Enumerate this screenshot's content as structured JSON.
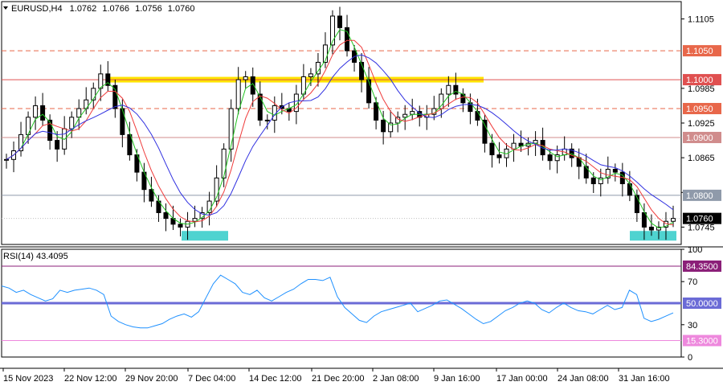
{
  "chart_data": {
    "type": "candlestick",
    "symbol_header": "EURUSD,H4",
    "ohlc_header": [
      "1.0762",
      "1.0766",
      "1.0756",
      "1.0760"
    ],
    "price_axis": {
      "range": [
        1.0715,
        1.1135
      ],
      "ticks": [
        1.1105,
        1.0985,
        1.0925,
        1.0865,
        1.0805,
        1.0745
      ],
      "levels": [
        {
          "value": 1.105,
          "label": "1.1050",
          "color": "#e8674a",
          "style": "dashed"
        },
        {
          "value": 1.1,
          "label": "1.1000",
          "color": "#e05050",
          "style": "solid"
        },
        {
          "value": 1.095,
          "label": "1.0950",
          "color": "#e8674a",
          "style": "dashed"
        },
        {
          "value": 1.09,
          "label": "1.0900",
          "color": "#d08c8c",
          "style": "solid"
        },
        {
          "value": 1.08,
          "label": "1.0800",
          "color": "#8f9aaa",
          "style": "solid"
        }
      ],
      "current_price": {
        "value": 1.076,
        "label": "1.0760",
        "color": "#000000"
      }
    },
    "x_labels": [
      "15 Nov 2023",
      "22 Nov 12:00",
      "29 Nov 20:00",
      "7 Dec 04:00",
      "14 Dec 12:00",
      "21 Dec 20:00",
      "2 Jan 08:00",
      "9 Jan 16:00",
      "17 Jan 00:00",
      "24 Jan 08:00",
      "31 Jan 16:00"
    ],
    "series": [
      {
        "kind": "price",
        "values": [
          1.0862,
          1.0877,
          1.0905,
          1.0935,
          1.0955,
          1.093,
          1.0895,
          1.088,
          1.0915,
          1.0935,
          1.095,
          1.0965,
          1.0985,
          1.101,
          1.099,
          1.095,
          1.0905,
          1.087,
          1.084,
          1.081,
          1.079,
          1.077,
          1.076,
          1.075,
          1.0745,
          1.0755,
          1.076,
          1.077,
          1.079,
          1.083,
          1.088,
          1.095,
          1.1,
          1.1005,
          1.0975,
          1.093,
          1.093,
          1.0955,
          1.095,
          1.0945,
          1.0975,
          1.1005,
          1.101,
          1.103,
          1.106,
          1.111,
          1.109,
          1.105,
          1.103,
          1.1,
          1.096,
          1.093,
          1.091,
          1.0925,
          1.0935,
          1.094,
          1.0945,
          1.0935,
          1.094,
          1.095,
          1.0975,
          1.099,
          1.0975,
          1.096,
          1.0945,
          1.093,
          1.089,
          1.087,
          1.0865,
          1.088,
          1.089,
          1.0885,
          1.089,
          1.0895,
          1.087,
          1.086,
          1.087,
          1.088,
          1.0865,
          1.085,
          1.083,
          1.082,
          1.083,
          1.0845,
          1.084,
          1.082,
          1.08,
          1.077,
          1.0745,
          1.074,
          1.0745,
          1.0755,
          1.076
        ]
      },
      {
        "kind": "ma-fast",
        "color": "#21c421"
      },
      {
        "kind": "ma-mid",
        "color": "#ef3b3b"
      },
      {
        "kind": "ma-slow",
        "color": "#3030e0"
      }
    ],
    "zones": [
      {
        "kind": "resistance",
        "color": "#ffe300",
        "value": 1.1
      },
      {
        "kind": "support",
        "color": "#4fd3d0",
        "value": 1.073
      },
      {
        "kind": "support",
        "color": "#4fd3d0",
        "value": 1.073
      }
    ]
  },
  "indicator": {
    "title": "RSI(14) 43.4095",
    "range": [
      0,
      100
    ],
    "ticks": [
      "100",
      "70",
      "30",
      "0"
    ],
    "levels": [
      {
        "value": 84.35,
        "label": "84.3500",
        "color": "#8b1f78",
        "thick": false
      },
      {
        "value": 50.0,
        "label": "50.0000",
        "color": "#6b6bd6",
        "thick": true
      },
      {
        "value": 15.3,
        "label": "15.3000",
        "color": "#ee88dd",
        "thick": false
      }
    ],
    "line_color": "#1e90ff",
    "values": [
      66,
      64,
      60,
      62,
      58,
      55,
      52,
      54,
      62,
      60,
      62,
      63,
      64,
      62,
      58,
      38,
      33,
      30,
      28,
      27,
      27,
      29,
      31,
      35,
      38,
      40,
      37,
      42,
      55,
      68,
      76,
      72,
      68,
      60,
      58,
      62,
      55,
      52,
      56,
      60,
      63,
      68,
      72,
      72,
      71,
      74,
      56,
      46,
      40,
      34,
      32,
      38,
      42,
      44,
      46,
      48,
      50,
      42,
      45,
      48,
      52,
      53,
      49,
      45,
      40,
      35,
      31,
      33,
      38,
      43,
      46,
      50,
      52,
      50,
      44,
      41,
      46,
      50,
      46,
      43,
      42,
      40,
      44,
      48,
      44,
      46,
      62,
      58,
      36,
      33,
      35,
      38,
      41
    ]
  }
}
